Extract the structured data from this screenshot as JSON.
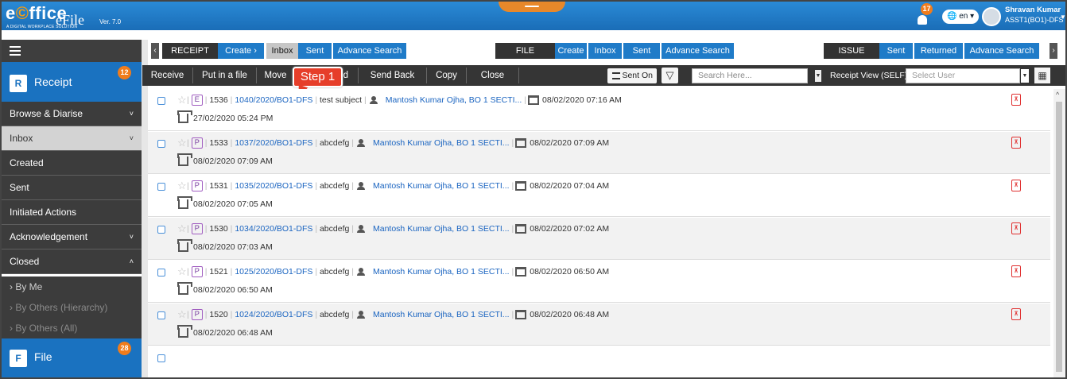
{
  "app": {
    "logo_text": "eOffice",
    "tagline": "A DIGITAL WORKPLACE SOLUTION",
    "product": "eFile",
    "version": "Ver. 7.0"
  },
  "header": {
    "notification_count": "17",
    "language": "en",
    "user_name": "Shravan Kumar",
    "user_designation": "ASST1(BO1)-DFS"
  },
  "sidebar": {
    "modules": [
      {
        "label": "Receipt",
        "icon": "receipt-icon",
        "count": "12"
      },
      {
        "label": "File",
        "icon": "file-icon",
        "count": "28"
      }
    ],
    "items": [
      {
        "label": "Browse & Diarise",
        "caret": "˅"
      },
      {
        "label": "Inbox",
        "caret": "˅"
      },
      {
        "label": "Created",
        "caret": ""
      },
      {
        "label": "Sent",
        "caret": ""
      },
      {
        "label": "Initiated Actions",
        "caret": ""
      },
      {
        "label": "Acknowledgement",
        "caret": "˅"
      },
      {
        "label": "Closed",
        "caret": "˄"
      }
    ],
    "sub_items": [
      "› By Me",
      "› By Others (Hierarchy)",
      "› By Others (All)"
    ]
  },
  "nav": {
    "receipt": {
      "head": "RECEIPT",
      "create": "Create ›",
      "inbox": "Inbox",
      "sent": "Sent",
      "advance": "Advance Search"
    },
    "file": {
      "head": "FILE",
      "create": "Create",
      "inbox": "Inbox",
      "sent": "Sent",
      "advance": "Advance Search"
    },
    "issue": {
      "head": "ISSUE",
      "sent": "Sent",
      "returned": "Returned",
      "advance": "Advance Search"
    }
  },
  "actions": {
    "receive": "Receive",
    "put_in_file": "Put in a file",
    "move": "Move",
    "hidden_d": "d",
    "send_back": "Send Back",
    "copy": "Copy",
    "close": "Close",
    "sent_on": "Sent On",
    "search_placeholder": "Search Here...",
    "receipt_view": "Receipt View (SELF)",
    "select_user_placeholder": "Select User"
  },
  "callout": {
    "text": "Step 1"
  },
  "receipts": [
    {
      "type": "E",
      "id": "1536",
      "number": "1040/2020/BO1-DFS",
      "subject": "test subject",
      "from": "Mantosh Kumar Ojha, BO 1 SECTI...",
      "sent_date": "08/02/2020 07:16 AM",
      "received_date": "27/02/2020 05:24 PM"
    },
    {
      "type": "P",
      "id": "1533",
      "number": "1037/2020/BO1-DFS",
      "subject": "abcdefg",
      "from": "Mantosh Kumar Ojha, BO 1 SECTI...",
      "sent_date": "08/02/2020 07:09 AM",
      "received_date": "08/02/2020 07:09 AM"
    },
    {
      "type": "P",
      "id": "1531",
      "number": "1035/2020/BO1-DFS",
      "subject": "abcdefg",
      "from": "Mantosh Kumar Ojha, BO 1 SECTI...",
      "sent_date": "08/02/2020 07:04 AM",
      "received_date": "08/02/2020 07:05 AM"
    },
    {
      "type": "P",
      "id": "1530",
      "number": "1034/2020/BO1-DFS",
      "subject": "abcdefg",
      "from": "Mantosh Kumar Ojha, BO 1 SECTI...",
      "sent_date": "08/02/2020 07:02 AM",
      "received_date": "08/02/2020 07:03 AM"
    },
    {
      "type": "P",
      "id": "1521",
      "number": "1025/2020/BO1-DFS",
      "subject": "abcdefg",
      "from": "Mantosh Kumar Ojha, BO 1 SECTI...",
      "sent_date": "08/02/2020 06:50 AM",
      "received_date": "08/02/2020 06:50 AM"
    },
    {
      "type": "P",
      "id": "1520",
      "number": "1024/2020/BO1-DFS",
      "subject": "abcdefg",
      "from": "Mantosh Kumar Ojha, BO 1 SECTI...",
      "sent_date": "08/02/2020 06:48 AM",
      "received_date": "08/02/2020 06:48 AM"
    }
  ],
  "colors": {
    "brand_blue": "#1f7bc8",
    "accent_orange": "#f07c1c",
    "callout_red": "#e63e2a",
    "pdf_red": "#e03030"
  }
}
